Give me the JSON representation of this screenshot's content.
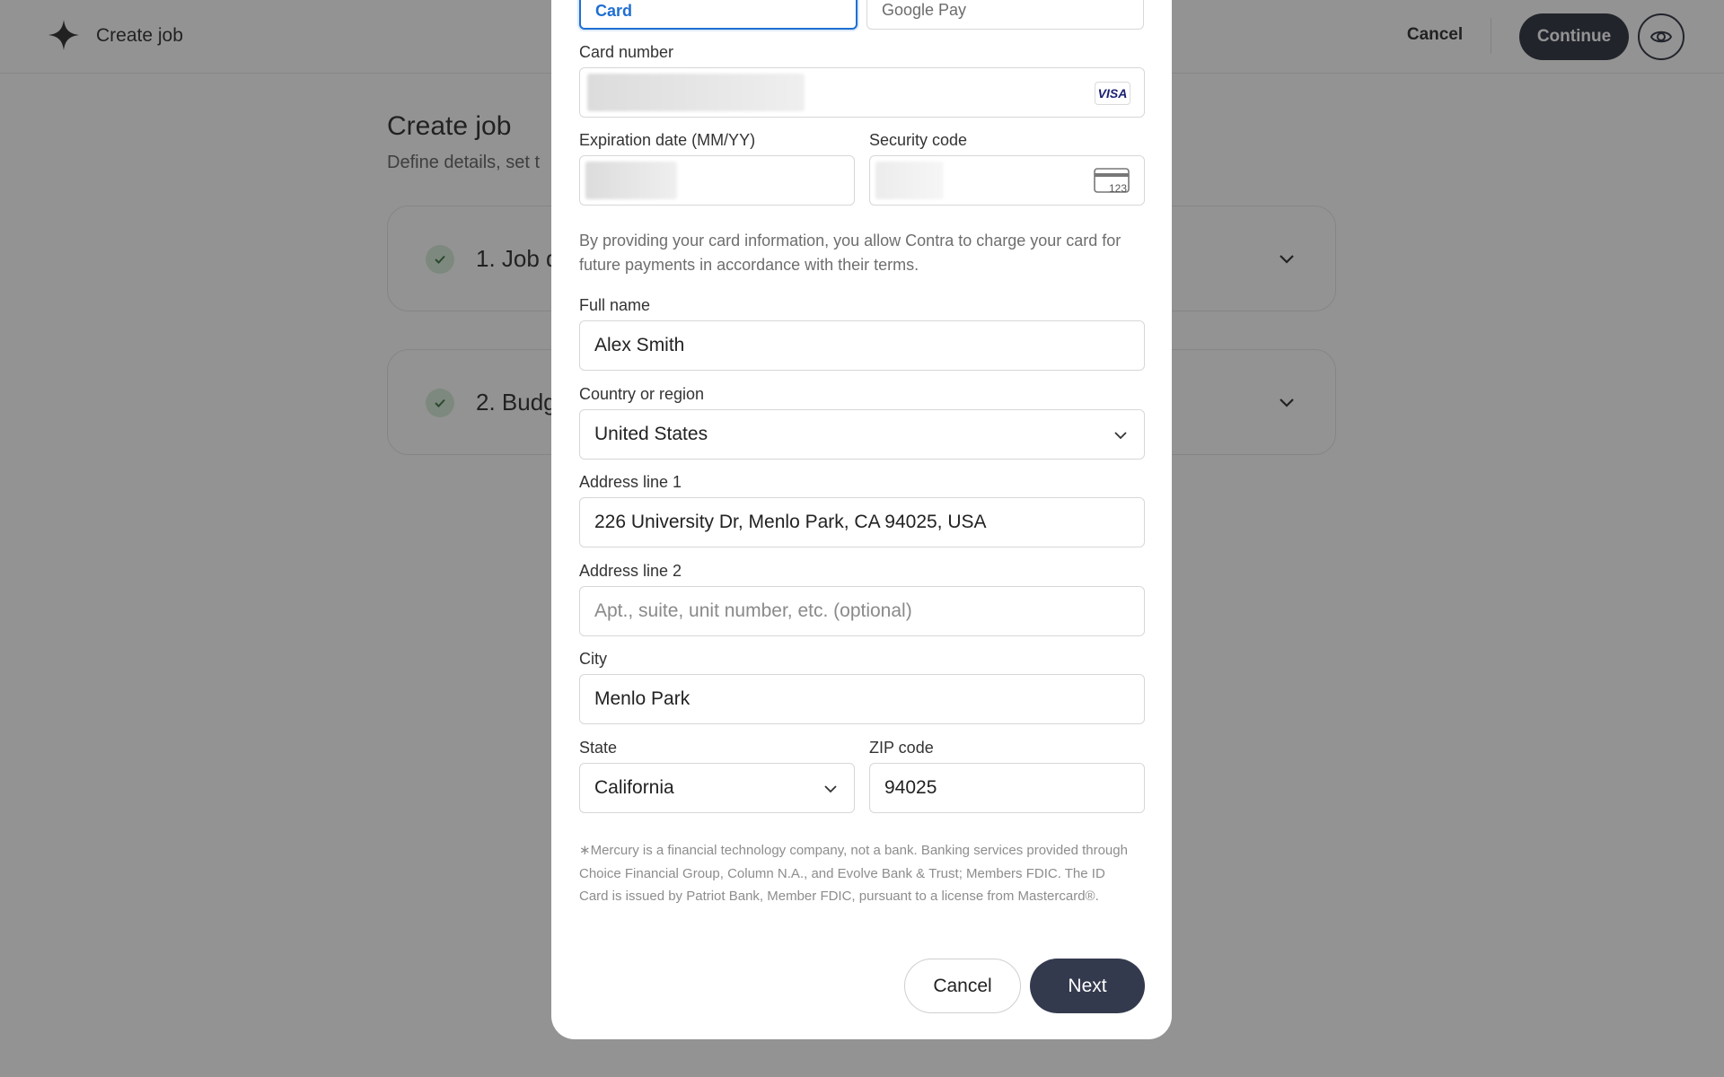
{
  "header": {
    "title": "Create job",
    "cancel_label": "Cancel",
    "continue_label": "Continue"
  },
  "page": {
    "title": "Create job",
    "subtitle": "Define details, set t",
    "sections": [
      {
        "label": "1. Job d"
      },
      {
        "label": "2. Budg"
      }
    ]
  },
  "payment_modal": {
    "tabs": [
      {
        "label": "Card",
        "selected": true
      },
      {
        "label": "Google Pay",
        "selected": false
      }
    ],
    "card_number": {
      "label": "Card number",
      "brand": "VISA"
    },
    "expiration": {
      "label": "Expiration date (MM/YY)"
    },
    "security_code": {
      "label": "Security code",
      "icon_text": "123"
    },
    "consent_text": "By providing your card information, you allow Contra to charge your card for future payments in accordance with their terms.",
    "full_name": {
      "label": "Full name",
      "value": "Alex Smith"
    },
    "country": {
      "label": "Country or region",
      "value": "United States"
    },
    "address_line_1": {
      "label": "Address line 1",
      "value": "226 University Dr, Menlo Park, CA 94025, USA"
    },
    "address_line_2": {
      "label": "Address line 2",
      "placeholder": "Apt., suite, unit number, etc. (optional)"
    },
    "city": {
      "label": "City",
      "value": "Menlo Park"
    },
    "state": {
      "label": "State",
      "value": "California"
    },
    "zip": {
      "label": "ZIP code",
      "value": "94025"
    },
    "disclaimer": "∗Mercury is a financial technology company, not a bank. Banking services provided through Choice Financial Group, Column N.A., and Evolve Bank & Trust; Members FDIC. The ID Card is issued by Patriot Bank, Member FDIC, pursuant to a license from Mastercard®.",
    "cancel_label": "Cancel",
    "next_label": "Next"
  },
  "colors": {
    "accent_blue": "#1f6fd1",
    "dark_button": "#1c2130",
    "next_button": "#343a4e",
    "check_green_bg": "#d3ebd4"
  }
}
